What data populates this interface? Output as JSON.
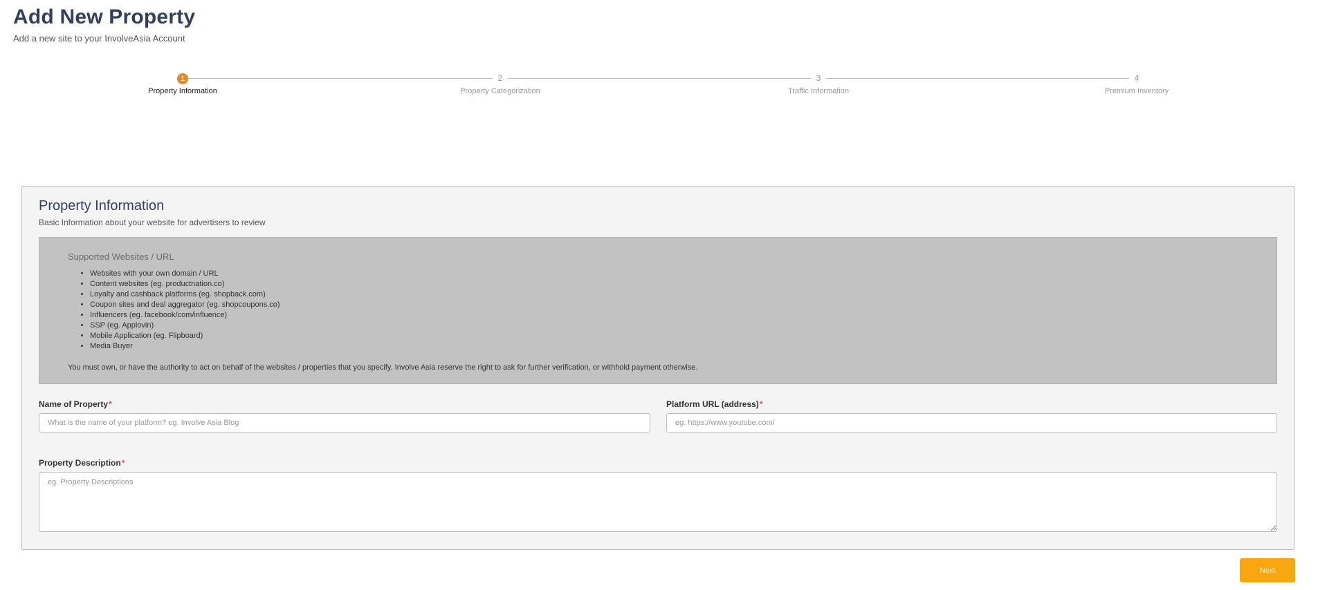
{
  "header": {
    "title": "Add New Property",
    "subtitle": "Add a new site to your InvolveAsia Account"
  },
  "stepper": {
    "active_index": 0,
    "steps": [
      {
        "number": "1",
        "label": "Property Information"
      },
      {
        "number": "2",
        "label": "Property Categorization"
      },
      {
        "number": "3",
        "label": "Traffic Information"
      },
      {
        "number": "4",
        "label": "Premium Inventory"
      }
    ]
  },
  "card": {
    "title": "Property Information",
    "subtitle": "Basic Information about your website for advertisers to review",
    "info": {
      "title": "Supported Websites / URL",
      "items": [
        "Websites with your own domain / URL",
        "Content websites (eg. productnation.co)",
        "Loyalty and cashback platforms (eg. shopback.com)",
        "Coupon sites and deal aggregator (eg. shopcoupons.co)",
        "Influencers (eg. facebook/com/influence)",
        "SSP (eg. Applovin)",
        "Mobile Application (eg. Flipboard)",
        "Media Buyer"
      ],
      "note": "You must own, or have the authority to act on behalf of the websites / properties that you specify. Involve Asia reserve the right to ask for further verification, or withhold payment otherwise."
    },
    "fields": {
      "name": {
        "label": "Name of Property",
        "required_mark": "*",
        "value": "",
        "placeholder": "What is the name of your platform? eg. Involve Asia Blog"
      },
      "url": {
        "label": "Platform URL (address)",
        "required_mark": "*",
        "value": "",
        "placeholder": "eg. https://www.youtube.com/"
      },
      "description": {
        "label": "Property Description",
        "required_mark": "*",
        "value": "",
        "placeholder": "eg. Property Descriptions"
      }
    }
  },
  "actions": {
    "next_label": "Next"
  },
  "colors": {
    "accent": "#f8a710",
    "step_active": "#e8862a",
    "title": "#34405a"
  }
}
